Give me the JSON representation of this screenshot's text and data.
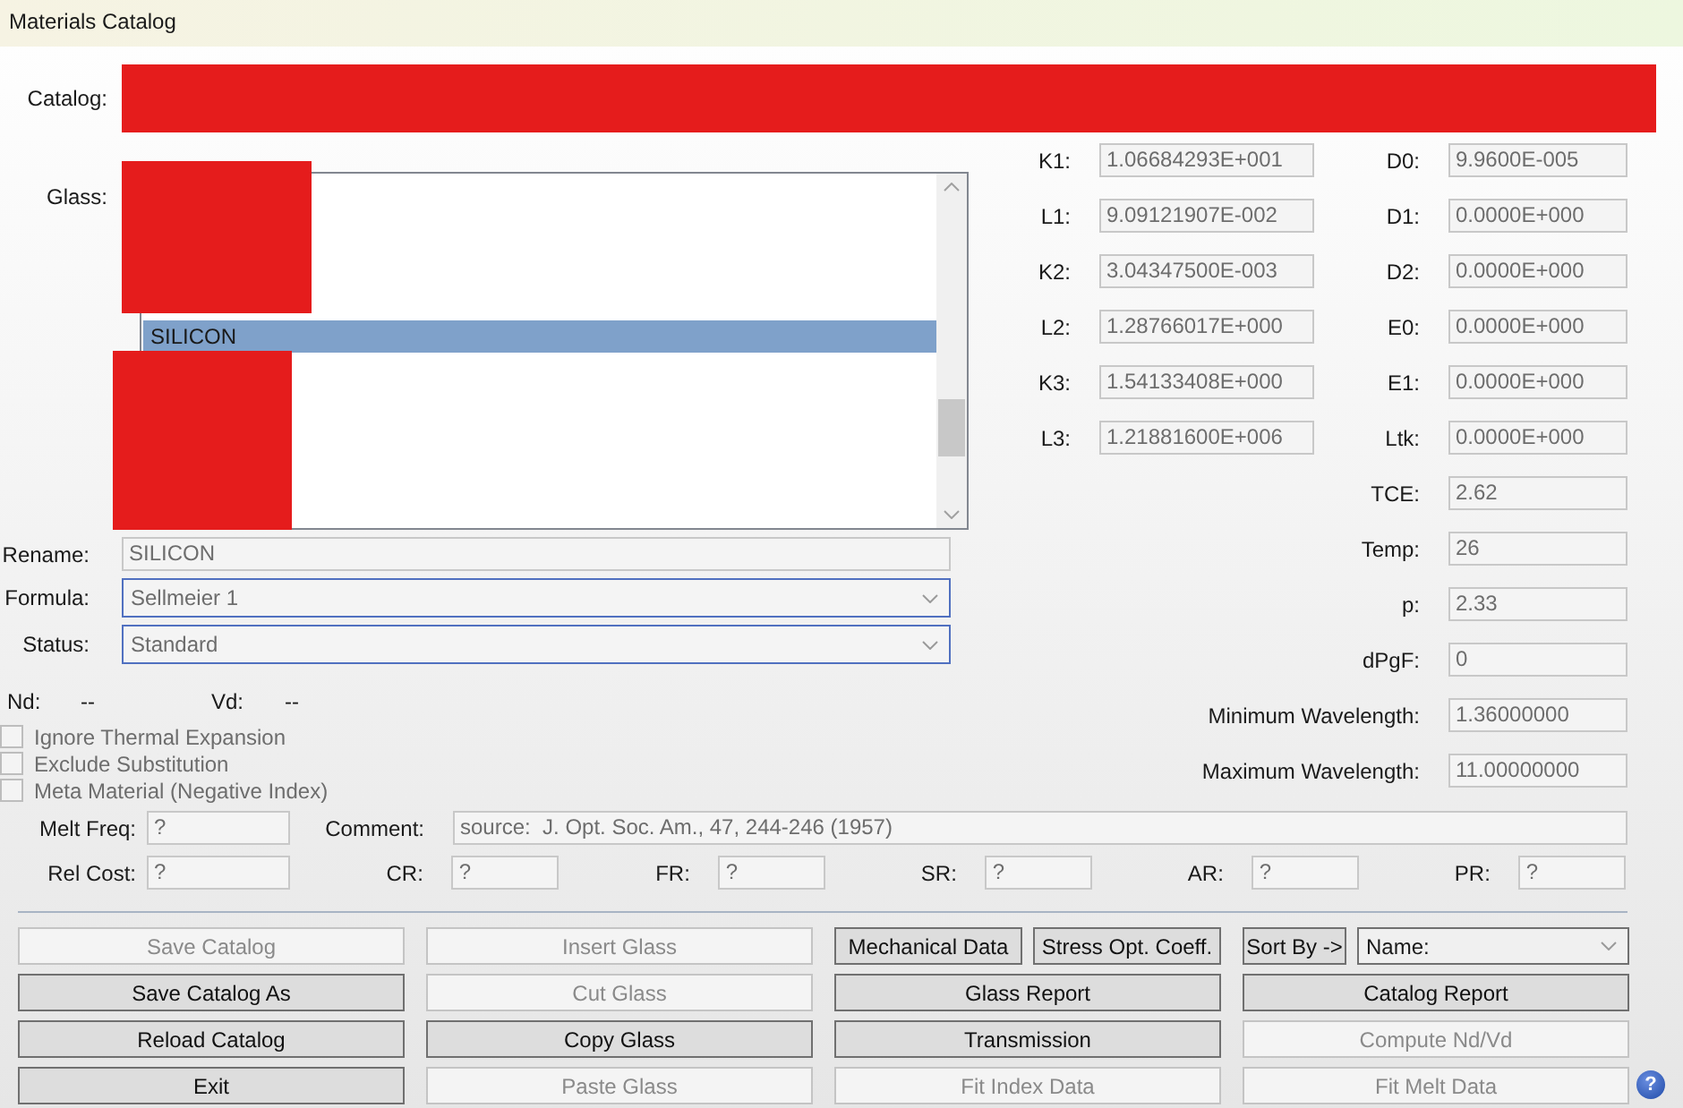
{
  "window": {
    "title": "Materials Catalog"
  },
  "catalog": {
    "label": "Catalog:"
  },
  "glass": {
    "label": "Glass:",
    "items": [
      {
        "name": "SILICON",
        "selected": true
      }
    ]
  },
  "fields": [
    {
      "label": "Rename:",
      "value": "SILICON",
      "kind": "text"
    },
    {
      "label": "Formula:",
      "value": "Sellmeier 1",
      "kind": "dropdown"
    },
    {
      "label": "Status:",
      "value": "Standard",
      "kind": "dropdown"
    }
  ],
  "indices": [
    {
      "label": "Nd:",
      "value": "--"
    },
    {
      "label": "Vd:",
      "value": "--"
    }
  ],
  "options": [
    {
      "label": "Ignore Thermal Expansion",
      "checked": false
    },
    {
      "label": "Exclude Substitution",
      "checked": false
    },
    {
      "label": "Meta Material (Negative Index)",
      "checked": false
    }
  ],
  "coefficients": [
    {
      "label": "K1:",
      "value": "1.06684293E+001"
    },
    {
      "label": "L1:",
      "value": "9.09121907E-002"
    },
    {
      "label": "K2:",
      "value": "3.04347500E-003"
    },
    {
      "label": "L2:",
      "value": "1.28766017E+000"
    },
    {
      "label": "K3:",
      "value": "1.54133408E+000"
    },
    {
      "label": "L3:",
      "value": "1.21881600E+006"
    }
  ],
  "parameters": [
    {
      "label": "D0:",
      "value": "9.9600E-005"
    },
    {
      "label": "D1:",
      "value": "0.0000E+000"
    },
    {
      "label": "D2:",
      "value": "0.0000E+000"
    },
    {
      "label": "E0:",
      "value": "0.0000E+000"
    },
    {
      "label": "E1:",
      "value": "0.0000E+000"
    },
    {
      "label": "Ltk:",
      "value": "0.0000E+000"
    },
    {
      "label": "TCE:",
      "value": "2.62"
    },
    {
      "label": "Temp:",
      "value": "26"
    },
    {
      "label": "p:",
      "value": "2.33"
    },
    {
      "label": "dPgF:",
      "value": "0"
    },
    {
      "label": "Minimum Wavelength:",
      "value": "1.36000000"
    },
    {
      "label": "Maximum Wavelength:",
      "value": "11.00000000"
    }
  ],
  "melt_freq": {
    "label": "Melt Freq:",
    "value": "?"
  },
  "comment": {
    "label": "Comment:",
    "value": "source:  J. Opt. Soc. Am., 47, 244-246 (1957)"
  },
  "costs": [
    {
      "label": "Rel Cost:",
      "value": "?"
    },
    {
      "label": "CR:",
      "value": "?"
    },
    {
      "label": "FR:",
      "value": "?"
    },
    {
      "label": "SR:",
      "value": "?"
    },
    {
      "label": "AR:",
      "value": "?"
    },
    {
      "label": "PR:",
      "value": "?"
    }
  ],
  "button_rows": [
    {
      "cells": [
        [
          {
            "kind": "button",
            "label": "Save Catalog",
            "disabled": true
          }
        ],
        [
          {
            "kind": "button",
            "label": "Insert Glass",
            "disabled": true
          }
        ],
        [
          {
            "kind": "button",
            "label": "Mechanical Data",
            "disabled": false
          },
          {
            "kind": "button",
            "label": "Stress Opt. Coeff.",
            "disabled": false
          }
        ],
        [
          {
            "kind": "button",
            "label": "Sort By ->",
            "disabled": false
          },
          {
            "kind": "dropdown",
            "label": "Name:",
            "disabled": false
          }
        ]
      ]
    },
    {
      "cells": [
        [
          {
            "kind": "button",
            "label": "Save Catalog As",
            "disabled": false
          }
        ],
        [
          {
            "kind": "button",
            "label": "Cut Glass",
            "disabled": true
          }
        ],
        [
          {
            "kind": "button",
            "label": "Glass Report",
            "disabled": false
          }
        ],
        [
          {
            "kind": "button",
            "label": "Catalog Report",
            "disabled": false
          }
        ]
      ]
    },
    {
      "cells": [
        [
          {
            "kind": "button",
            "label": "Reload Catalog",
            "disabled": false
          }
        ],
        [
          {
            "kind": "button",
            "label": "Copy Glass",
            "disabled": false
          }
        ],
        [
          {
            "kind": "button",
            "label": "Transmission",
            "disabled": false
          }
        ],
        [
          {
            "kind": "button",
            "label": "Compute Nd/Vd",
            "disabled": true
          }
        ]
      ]
    },
    {
      "cells": [
        [
          {
            "kind": "button",
            "label": "Exit",
            "disabled": false
          }
        ],
        [
          {
            "kind": "button",
            "label": "Paste Glass",
            "disabled": true
          }
        ],
        [
          {
            "kind": "button",
            "label": "Fit Index Data",
            "disabled": true
          }
        ],
        [
          {
            "kind": "button",
            "label": "Fit Melt Data",
            "disabled": true
          }
        ]
      ]
    }
  ],
  "help": {
    "symbol": "?"
  }
}
